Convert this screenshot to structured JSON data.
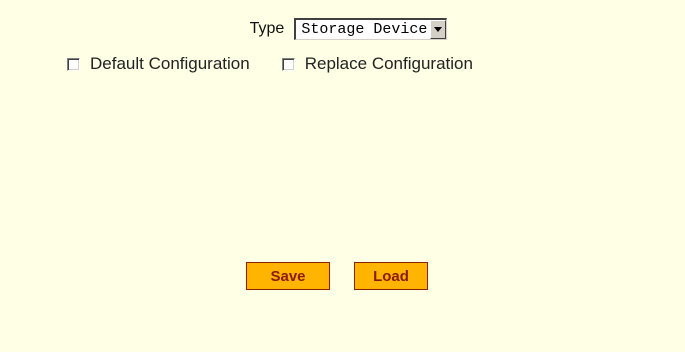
{
  "form": {
    "type_label": "Type",
    "type_select": {
      "selected": "Storage Device"
    },
    "checkboxes": [
      {
        "label": "Default Configuration",
        "checked": false
      },
      {
        "label": "Replace Configuration",
        "checked": false
      }
    ]
  },
  "buttons": {
    "save_label": "Save",
    "load_label": "Load"
  },
  "colors": {
    "panel_background": "#ffffe6",
    "button_fill": "#ffb400",
    "button_text": "#8b1a00"
  }
}
